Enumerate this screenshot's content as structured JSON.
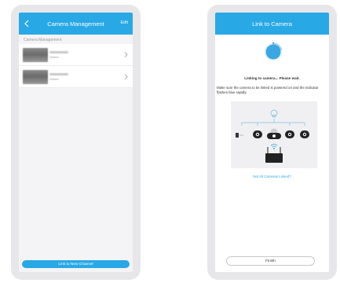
{
  "left_screen": {
    "header": {
      "title": "Camera Management",
      "edit_label": "Edit"
    },
    "section_label": "Camera Management",
    "cameras": [
      {
        "status": "Online"
      },
      {
        "status": "Online"
      }
    ],
    "link_button_label": "Link to New Channel"
  },
  "right_screen": {
    "header": {
      "title": "Link to Camera"
    },
    "progress": 0.22,
    "linking_text": "Linking to camera... Please wait.",
    "instruction": "Make sure the camera to be linked is powered on and the indicator flashes blue rapidly.",
    "not_linked_link": "Not All Cameras Linked?",
    "finish_label": "Finish"
  },
  "colors": {
    "accent": "#29a8e6",
    "background": "#f4f4f6",
    "frame": "#e7e7e9"
  },
  "icons": [
    "back-arrow-icon",
    "chevron-right-icon",
    "plug-icon",
    "wifi-icon",
    "router-icon",
    "camera-icon"
  ]
}
